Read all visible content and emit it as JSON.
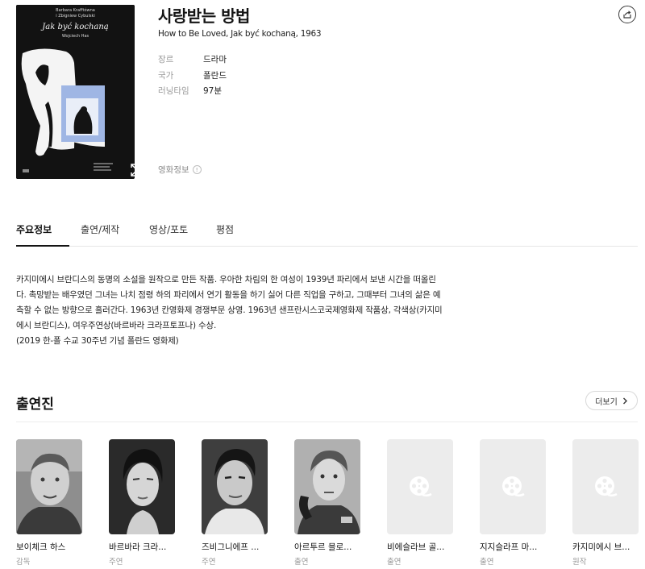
{
  "movie": {
    "title": "사랑받는 방법",
    "subtitle": "How to Be Loved, Jak być kochaną, 1963",
    "info_label": "영화정보",
    "details": [
      {
        "key": "장르",
        "value": "드라마"
      },
      {
        "key": "국가",
        "value": "폴란드"
      },
      {
        "key": "러닝타임",
        "value": "97분"
      }
    ]
  },
  "poster": {
    "credit_line1": "Barbara Krafftówna",
    "credit_line2": "i Zbigniew Cybulski",
    "title": "Jak być kochaną",
    "director": "Wojciech Has"
  },
  "tabs": [
    {
      "label": "주요정보",
      "active": true
    },
    {
      "label": "출연/제작",
      "active": false
    },
    {
      "label": "영상/포토",
      "active": false
    },
    {
      "label": "평점",
      "active": false
    }
  ],
  "synopsis": [
    "카지미에시 브란디스의 동명의 소설을 원작으로 만든 작품. 우아한 차림의 한 여성이 1939년 파리에서 보낸 시간을 떠올린",
    "다. 촉망받는 배우였던 그녀는 나치 점령 하의 파리에서 연기 활동을 하기 싫어 다른 직업을 구하고, 그때부터 그녀의 삶은 예",
    "측할 수 없는 방향으로 흘러간다. 1963년 칸영화제 경쟁부문 상영. 1963년 샌프란시스코국제영화제 작품상, 각색상(카지미",
    "에시 브란디스), 여우주연상(바르바라 크라프토프나) 수상.",
    "(2019 한-폴 수교 30주년 기념 폴란드 영화제)"
  ],
  "cast": {
    "heading": "출연진",
    "more_label": "더보기",
    "members": [
      {
        "name": "보이체크 하스",
        "role": "감독",
        "has_photo": true
      },
      {
        "name": "바르바라 크라...",
        "role": "주연",
        "has_photo": true
      },
      {
        "name": "즈비그니에프 ...",
        "role": "주연",
        "has_photo": true
      },
      {
        "name": "아르투르 믈로...",
        "role": "출연",
        "has_photo": true
      },
      {
        "name": "비에슬라브 골...",
        "role": "출연",
        "has_photo": false
      },
      {
        "name": "지지슬라프 마...",
        "role": "출연",
        "has_photo": false
      },
      {
        "name": "카지미에시 브...",
        "role": "원작",
        "has_photo": false
      }
    ]
  },
  "colors": {
    "poster_bg": "#121212",
    "poster_accent": "#9fb6e4",
    "muted_text": "#9a9a9a",
    "placeholder_bg": "#ececec"
  }
}
